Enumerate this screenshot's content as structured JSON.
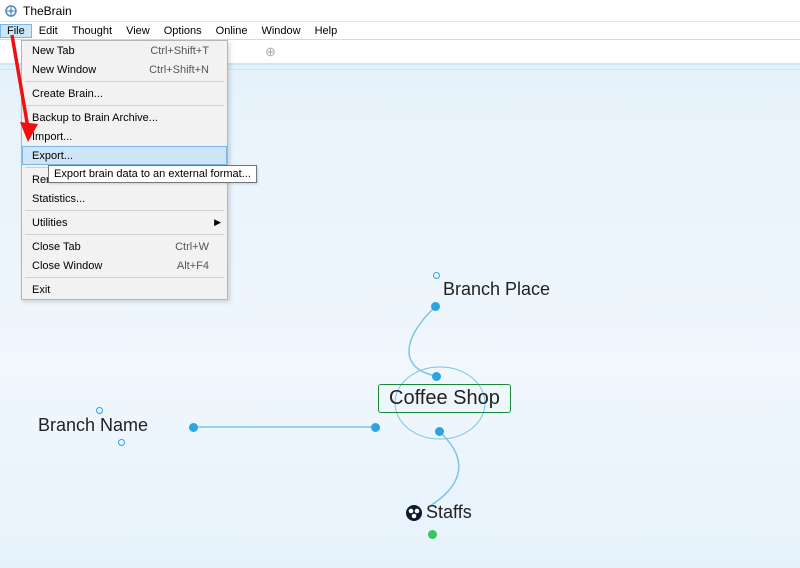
{
  "app": {
    "title": "TheBrain"
  },
  "menubar": {
    "items": [
      "File",
      "Edit",
      "Thought",
      "View",
      "Options",
      "Online",
      "Window",
      "Help"
    ],
    "active_index": 0
  },
  "file_menu": {
    "groups": [
      [
        {
          "label": "New Tab",
          "shortcut": "Ctrl+Shift+T"
        },
        {
          "label": "New Window",
          "shortcut": "Ctrl+Shift+N"
        }
      ],
      [
        {
          "label": "Create Brain...",
          "shortcut": ""
        }
      ],
      [
        {
          "label": "Backup to Brain Archive...",
          "shortcut": ""
        },
        {
          "label": "Import...",
          "shortcut": ""
        },
        {
          "label": "Export...",
          "shortcut": "",
          "highlight": true
        }
      ],
      [
        {
          "label": "Rename Brain...",
          "shortcut": ""
        },
        {
          "label": "Statistics...",
          "shortcut": ""
        }
      ],
      [
        {
          "label": "Utilities",
          "shortcut": "",
          "submenu": true
        }
      ],
      [
        {
          "label": "Close Tab",
          "shortcut": "Ctrl+W"
        },
        {
          "label": "Close Window",
          "shortcut": "Alt+F4"
        }
      ],
      [
        {
          "label": "Exit",
          "shortcut": ""
        }
      ]
    ],
    "tooltip": "Export brain data to an external format..."
  },
  "nodes": {
    "central": "Coffee Shop",
    "top": "Branch Place",
    "left": "Branch Name",
    "bottom": "Staffs"
  }
}
